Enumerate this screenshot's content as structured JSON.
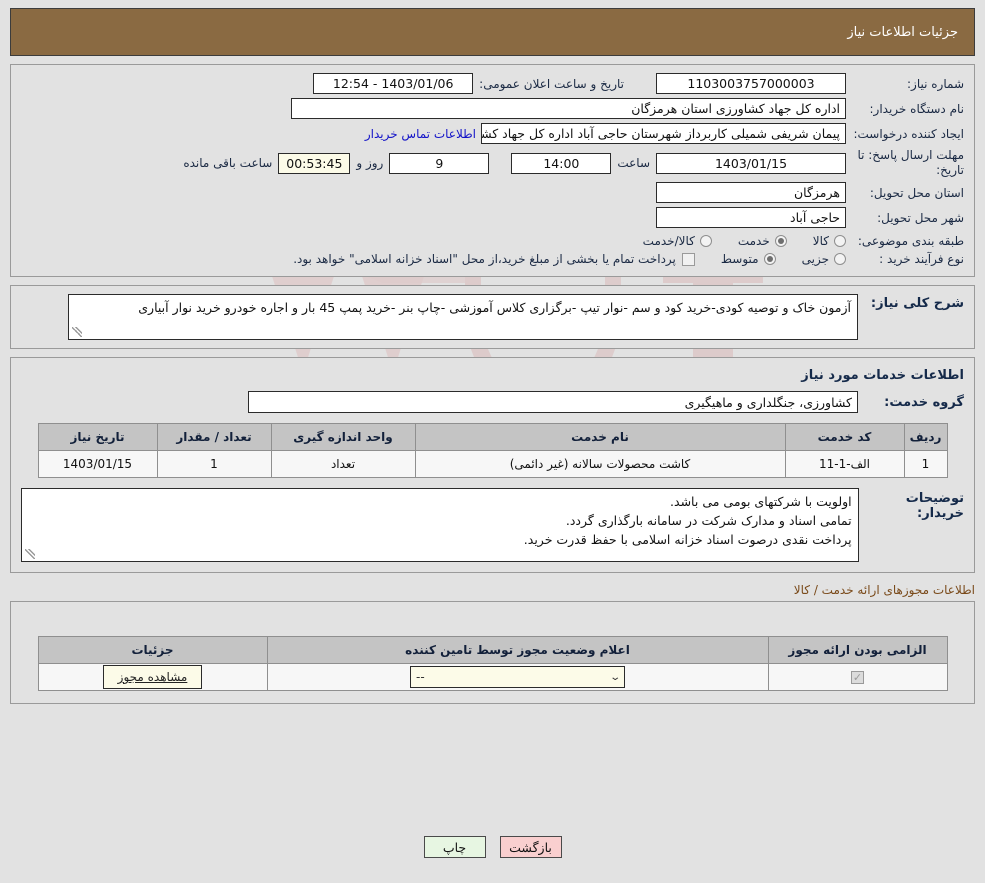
{
  "header": {
    "title": "جزئیات اطلاعات نیاز"
  },
  "summary": {
    "need_number_label": "شماره نیاز:",
    "need_number_value": "1103003757000003",
    "public_announce_label": "تاریخ و ساعت اعلان عمومی:",
    "public_announce_value": "1403/01/06 - 12:54",
    "buyer_org_label": "نام دستگاه خریدار:",
    "buyer_org_value": "اداره کل جهاد کشاورزی استان هرمزگان",
    "creator_label": "ایجاد کننده درخواست:",
    "creator_value": "پیمان شریفی شمیلی کاربرداز شهرستان حاجی آباد اداره کل جهاد کشاورزی اس",
    "contact_link": "اطلاعات تماس خریدار",
    "deadline_label": "مهلت ارسال پاسخ: تا تاریخ:",
    "deadline_date": "1403/01/15",
    "deadline_hour_label": "ساعت",
    "deadline_hour": "14:00",
    "days_value": "9",
    "days_label": "روز و",
    "countdown": "00:53:45",
    "countdown_label": "ساعت باقی مانده",
    "province_label": "استان محل تحویل:",
    "province_value": "هرمزگان",
    "city_label": "شهر محل تحویل:",
    "city_value": "حاجی آباد",
    "category_label": "طبقه بندی موضوعی:",
    "category_options": [
      {
        "label": "کالا",
        "selected": false
      },
      {
        "label": "خدمت",
        "selected": true
      },
      {
        "label": "کالا/خدمت",
        "selected": false
      }
    ],
    "process_label": "نوع فرآیند خرید :",
    "process_options": [
      {
        "label": "جزیی",
        "selected": false
      },
      {
        "label": "متوسط",
        "selected": true
      }
    ],
    "treasury_checkbox_checked": false,
    "treasury_text": "پرداخت تمام یا بخشی از مبلغ خرید،از محل \"اسناد خزانه اسلامی\" خواهد بود."
  },
  "need_description": {
    "label": "شرح کلی نیاز:",
    "value": "آزمون خاک و توصیه کودی-خرید کود و سم -نوار تیپ -برگزاری کلاس آموزشی -چاپ بنر -خرید پمپ 45 بار و اجاره خودرو خرید نوار آبیاری"
  },
  "services_section": {
    "heading": "اطلاعات خدمات مورد نیاز",
    "group_label": "گروه خدمت:",
    "group_value": "کشاورزی، جنگلداری و ماهیگیری",
    "table": {
      "columns": [
        "ردیف",
        "کد خدمت",
        "نام خدمت",
        "واحد اندازه گیری",
        "تعداد / مقدار",
        "تاریخ نیاز"
      ],
      "rows": [
        [
          "1",
          "الف-1-11",
          "کاشت محصولات سالانه (غیر دائمی)",
          "تعداد",
          "1",
          "1403/01/15"
        ]
      ]
    },
    "buyer_notes_label": "توضیحات خریدار:",
    "buyer_notes_lines": [
      "اولویت با شرکتهای بومی می باشد.",
      "تمامی اسناد و مدارک شرکت در سامانه بارگذاری گردد.",
      "پرداخت نقدی درصوت اسناد خزانه اسلامی با حفظ قدرت خرید."
    ]
  },
  "licenses_section": {
    "heading": "اطلاعات مجوزهای ارائه خدمت / کالا",
    "table": {
      "columns": [
        "الزامی بودن ارائه مجوز",
        "اعلام وضعیت مجوز توسط تامین کننده",
        "جزئیات"
      ],
      "rows": [
        {
          "required_checked": true,
          "status_value": "--",
          "detail_button": "مشاهده مجوز"
        }
      ]
    }
  },
  "footer": {
    "print_label": "چاپ",
    "back_label": "بازگشت"
  },
  "colors": {
    "header_bg": "#8a6a42",
    "link": "#1313c8",
    "heading": "#152a4a",
    "brown_heading": "#7a4a1a",
    "print_btn": "#e7f6e2",
    "back_btn": "#f9cfcf",
    "cream_field": "#fcfbe8"
  }
}
